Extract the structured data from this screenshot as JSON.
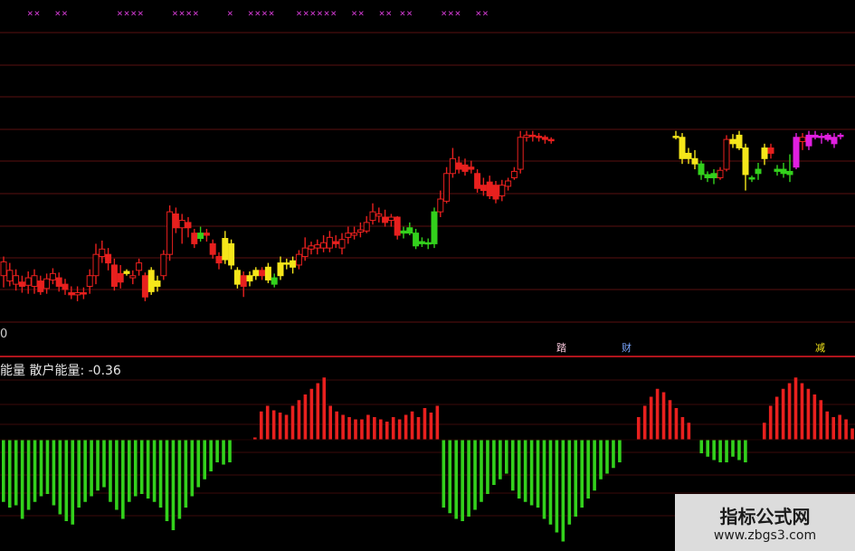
{
  "top_marks": "××  ××       ××××    ××××    ×  ××××   ××××××  ××  ×× ××    ×××  ××",
  "zero_label": "0",
  "indicator_label": "能量  散户能量: -0.36",
  "markers": [
    "踏",
    "财",
    "减"
  ],
  "watermark": {
    "title": "指标公式网",
    "url": "www.zbgs3.com"
  },
  "colors": {
    "up": "#e8201e",
    "down": "#e8201e",
    "yellow": "#f5e61a",
    "green": "#33d11c",
    "magenta": "#e01fe0",
    "grid": "#5a0f0f",
    "divider": "#b0141c"
  },
  "chart_data": [
    {
      "type": "candlestick",
      "note": "price candles, colored by signal",
      "candles": [
        {
          "o": 300,
          "c": 313,
          "h": 318,
          "l": 289,
          "col": "red"
        },
        {
          "o": 295,
          "c": 305,
          "h": 312,
          "l": 290,
          "col": "red"
        },
        {
          "o": 292,
          "c": 300,
          "h": 306,
          "l": 286,
          "col": "red"
        },
        {
          "o": 294,
          "c": 290,
          "h": 300,
          "l": 284,
          "col": "red"
        },
        {
          "o": 291,
          "c": 298,
          "h": 304,
          "l": 283,
          "col": "red"
        },
        {
          "o": 290,
          "c": 300,
          "h": 306,
          "l": 283,
          "col": "red"
        },
        {
          "o": 295,
          "c": 285,
          "h": 300,
          "l": 282,
          "col": "red"
        },
        {
          "o": 288,
          "c": 297,
          "h": 302,
          "l": 283,
          "col": "red"
        },
        {
          "o": 296,
          "c": 302,
          "h": 307,
          "l": 292,
          "col": "red"
        },
        {
          "o": 298,
          "c": 290,
          "h": 303,
          "l": 285,
          "col": "red"
        },
        {
          "o": 292,
          "c": 287,
          "h": 297,
          "l": 282,
          "col": "red"
        },
        {
          "o": 284,
          "c": 282,
          "h": 290,
          "l": 278,
          "col": "red"
        },
        {
          "o": 282,
          "c": 284,
          "h": 290,
          "l": 276,
          "col": "red"
        },
        {
          "o": 284,
          "c": 283,
          "h": 289,
          "l": 278,
          "col": "red"
        },
        {
          "o": 290,
          "c": 300,
          "h": 306,
          "l": 283,
          "col": "red"
        },
        {
          "o": 300,
          "c": 320,
          "h": 330,
          "l": 292,
          "col": "red"
        },
        {
          "o": 318,
          "c": 325,
          "h": 333,
          "l": 312,
          "col": "red"
        },
        {
          "o": 320,
          "c": 312,
          "h": 326,
          "l": 305,
          "col": "red"
        },
        {
          "o": 310,
          "c": 290,
          "h": 316,
          "l": 286,
          "col": "red"
        },
        {
          "o": 302,
          "c": 294,
          "h": 310,
          "l": 288,
          "col": "red"
        },
        {
          "o": 302,
          "c": 304,
          "h": 306,
          "l": 300,
          "col": "yellow"
        },
        {
          "o": 298,
          "c": 300,
          "h": 305,
          "l": 292,
          "col": "red"
        },
        {
          "o": 305,
          "c": 312,
          "h": 316,
          "l": 300,
          "col": "red"
        },
        {
          "o": 300,
          "c": 280,
          "h": 303,
          "l": 276,
          "col": "red"
        },
        {
          "o": 285,
          "c": 305,
          "h": 308,
          "l": 282,
          "col": "yellow"
        },
        {
          "o": 295,
          "c": 290,
          "h": 300,
          "l": 285,
          "col": "yellow"
        },
        {
          "o": 300,
          "c": 320,
          "h": 324,
          "l": 296,
          "col": "red"
        },
        {
          "o": 320,
          "c": 360,
          "h": 366,
          "l": 314,
          "col": "red"
        },
        {
          "o": 358,
          "c": 345,
          "h": 364,
          "l": 340,
          "col": "red"
        },
        {
          "o": 345,
          "c": 352,
          "h": 358,
          "l": 330,
          "col": "red"
        },
        {
          "o": 350,
          "c": 345,
          "h": 355,
          "l": 336,
          "col": "red"
        },
        {
          "o": 340,
          "c": 330,
          "h": 344,
          "l": 326,
          "col": "red"
        },
        {
          "o": 335,
          "c": 340,
          "h": 346,
          "l": 332,
          "col": "green"
        },
        {
          "o": 340,
          "c": 338,
          "h": 344,
          "l": 332,
          "col": "red"
        },
        {
          "o": 330,
          "c": 320,
          "h": 334,
          "l": 316,
          "col": "red"
        },
        {
          "o": 318,
          "c": 312,
          "h": 322,
          "l": 306,
          "col": "red"
        },
        {
          "o": 315,
          "c": 335,
          "h": 342,
          "l": 311,
          "col": "yellow"
        },
        {
          "o": 330,
          "c": 310,
          "h": 334,
          "l": 306,
          "col": "yellow"
        },
        {
          "o": 305,
          "c": 292,
          "h": 308,
          "l": 288,
          "col": "yellow"
        },
        {
          "o": 300,
          "c": 290,
          "h": 304,
          "l": 280,
          "col": "red"
        },
        {
          "o": 295,
          "c": 300,
          "h": 304,
          "l": 290,
          "col": "yellow"
        },
        {
          "o": 300,
          "c": 305,
          "h": 308,
          "l": 296,
          "col": "yellow"
        },
        {
          "o": 305,
          "c": 300,
          "h": 308,
          "l": 296,
          "col": "red"
        },
        {
          "o": 296,
          "c": 308,
          "h": 312,
          "l": 293,
          "col": "yellow"
        },
        {
          "o": 298,
          "c": 292,
          "h": 302,
          "l": 289,
          "col": "green"
        },
        {
          "o": 300,
          "c": 312,
          "h": 318,
          "l": 296,
          "col": "yellow"
        },
        {
          "o": 312,
          "c": 312,
          "h": 316,
          "l": 306,
          "col": "yellow"
        },
        {
          "o": 314,
          "c": 308,
          "h": 318,
          "l": 302,
          "col": "yellow"
        },
        {
          "o": 310,
          "c": 320,
          "h": 324,
          "l": 306,
          "col": "red"
        },
        {
          "o": 318,
          "c": 326,
          "h": 336,
          "l": 314,
          "col": "red"
        },
        {
          "o": 325,
          "c": 328,
          "h": 332,
          "l": 320,
          "col": "red"
        },
        {
          "o": 326,
          "c": 329,
          "h": 334,
          "l": 320,
          "col": "red"
        },
        {
          "o": 326,
          "c": 331,
          "h": 338,
          "l": 322,
          "col": "red"
        },
        {
          "o": 326,
          "c": 336,
          "h": 342,
          "l": 322,
          "col": "red"
        },
        {
          "o": 332,
          "c": 330,
          "h": 338,
          "l": 326,
          "col": "red"
        },
        {
          "o": 326,
          "c": 334,
          "h": 340,
          "l": 320,
          "col": "red"
        },
        {
          "o": 336,
          "c": 340,
          "h": 346,
          "l": 330,
          "col": "red"
        },
        {
          "o": 338,
          "c": 340,
          "h": 346,
          "l": 334,
          "col": "red"
        },
        {
          "o": 341,
          "c": 343,
          "h": 350,
          "l": 336,
          "col": "red"
        },
        {
          "o": 342,
          "c": 350,
          "h": 356,
          "l": 340,
          "col": "red"
        },
        {
          "o": 352,
          "c": 360,
          "h": 368,
          "l": 348,
          "col": "red"
        },
        {
          "o": 356,
          "c": 358,
          "h": 364,
          "l": 350,
          "col": "red"
        },
        {
          "o": 355,
          "c": 350,
          "h": 362,
          "l": 346,
          "col": "red"
        },
        {
          "o": 352,
          "c": 355,
          "h": 358,
          "l": 346,
          "col": "red"
        },
        {
          "o": 355,
          "c": 338,
          "h": 356,
          "l": 334,
          "col": "red"
        },
        {
          "o": 340,
          "c": 342,
          "h": 346,
          "l": 335,
          "col": "green"
        },
        {
          "o": 345,
          "c": 340,
          "h": 350,
          "l": 338,
          "col": "green"
        },
        {
          "o": 340,
          "c": 328,
          "h": 344,
          "l": 325,
          "col": "green"
        },
        {
          "o": 332,
          "c": 330,
          "h": 336,
          "l": 327,
          "col": "green"
        },
        {
          "o": 330,
          "c": 331,
          "h": 335,
          "l": 325,
          "col": "green"
        },
        {
          "o": 330,
          "c": 360,
          "h": 364,
          "l": 326,
          "col": "green"
        },
        {
          "o": 360,
          "c": 372,
          "h": 380,
          "l": 355,
          "col": "red"
        },
        {
          "o": 370,
          "c": 396,
          "h": 402,
          "l": 368,
          "col": "red"
        },
        {
          "o": 396,
          "c": 410,
          "h": 420,
          "l": 392,
          "col": "red"
        },
        {
          "o": 406,
          "c": 400,
          "h": 412,
          "l": 396,
          "col": "red"
        },
        {
          "o": 404,
          "c": 398,
          "h": 410,
          "l": 394,
          "col": "red"
        },
        {
          "o": 402,
          "c": 400,
          "h": 408,
          "l": 396,
          "col": "red"
        },
        {
          "o": 396,
          "c": 382,
          "h": 400,
          "l": 378,
          "col": "red"
        },
        {
          "o": 385,
          "c": 380,
          "h": 392,
          "l": 375,
          "col": "red"
        },
        {
          "o": 388,
          "c": 375,
          "h": 394,
          "l": 372,
          "col": "red"
        },
        {
          "o": 385,
          "c": 372,
          "h": 389,
          "l": 368,
          "col": "red"
        },
        {
          "o": 375,
          "c": 385,
          "h": 390,
          "l": 370,
          "col": "red"
        },
        {
          "o": 384,
          "c": 389,
          "h": 392,
          "l": 380,
          "col": "red"
        },
        {
          "o": 392,
          "c": 398,
          "h": 402,
          "l": 390,
          "col": "red"
        },
        {
          "o": 400,
          "c": 430,
          "h": 436,
          "l": 396,
          "col": "red"
        },
        {
          "o": 430,
          "c": 432,
          "h": 436,
          "l": 426,
          "col": "red"
        },
        {
          "o": 432,
          "c": 431,
          "h": 436,
          "l": 426,
          "col": "red"
        },
        {
          "o": 431,
          "c": 430,
          "h": 434,
          "l": 426,
          "col": "red"
        },
        {
          "o": 430,
          "c": 428,
          "h": 432,
          "l": 424,
          "col": "red"
        },
        {
          "o": 428,
          "c": 427,
          "h": 430,
          "l": 424,
          "col": "red"
        }
      ],
      "candles_right": [
        {
          "o": 430,
          "c": 431,
          "h": 436,
          "l": 428,
          "col": "yellow"
        },
        {
          "o": 430,
          "c": 410,
          "h": 434,
          "l": 405,
          "col": "yellow"
        },
        {
          "o": 410,
          "c": 415,
          "h": 420,
          "l": 405,
          "col": "yellow"
        },
        {
          "o": 410,
          "c": 405,
          "h": 418,
          "l": 400,
          "col": "yellow"
        },
        {
          "o": 405,
          "c": 395,
          "h": 408,
          "l": 390,
          "col": "green"
        },
        {
          "o": 392,
          "c": 395,
          "h": 398,
          "l": 388,
          "col": "green"
        },
        {
          "o": 396,
          "c": 392,
          "h": 400,
          "l": 386,
          "col": "green"
        },
        {
          "o": 392,
          "c": 399,
          "h": 402,
          "l": 390,
          "col": "red"
        },
        {
          "o": 400,
          "c": 428,
          "h": 432,
          "l": 398,
          "col": "red"
        },
        {
          "o": 428,
          "c": 424,
          "h": 433,
          "l": 420,
          "col": "yellow"
        },
        {
          "o": 420,
          "c": 432,
          "h": 436,
          "l": 418,
          "col": "yellow"
        },
        {
          "o": 420,
          "c": 395,
          "h": 424,
          "l": 380,
          "col": "yellow"
        },
        {
          "o": 392,
          "c": 392,
          "h": 394,
          "l": 388,
          "col": "green"
        },
        {
          "o": 396,
          "c": 400,
          "h": 406,
          "l": 390,
          "col": "green"
        },
        {
          "o": 410,
          "c": 420,
          "h": 424,
          "l": 404,
          "col": "yellow"
        },
        {
          "o": 420,
          "c": 415,
          "h": 424,
          "l": 410,
          "col": "red"
        },
        {
          "o": 400,
          "c": 398,
          "h": 404,
          "l": 394,
          "col": "green"
        },
        {
          "o": 396,
          "c": 400,
          "h": 406,
          "l": 392,
          "col": "green"
        },
        {
          "o": 395,
          "c": 398,
          "h": 414,
          "l": 388,
          "col": "green"
        },
        {
          "o": 402,
          "c": 430,
          "h": 434,
          "l": 400,
          "col": "magenta"
        },
        {
          "o": 426,
          "c": 430,
          "h": 434,
          "l": 418,
          "col": "red"
        },
        {
          "o": 422,
          "c": 432,
          "h": 436,
          "l": 418,
          "col": "magenta"
        },
        {
          "o": 432,
          "c": 430,
          "h": 436,
          "l": 428,
          "col": "magenta"
        },
        {
          "o": 431,
          "c": 430,
          "h": 434,
          "l": 424,
          "col": "magenta"
        },
        {
          "o": 428,
          "c": 432,
          "h": 434,
          "l": 426,
          "col": "magenta"
        },
        {
          "o": 430,
          "c": 424,
          "h": 434,
          "l": 420,
          "col": "magenta"
        },
        {
          "o": 432,
          "c": 431,
          "h": 434,
          "l": 428,
          "col": "magenta"
        }
      ]
    },
    {
      "type": "bar",
      "series_label": "散户能量",
      "last_value": -0.36,
      "values": [
        -0.55,
        -0.6,
        -0.58,
        -0.7,
        -0.62,
        -0.55,
        -0.5,
        -0.48,
        -0.58,
        -0.66,
        -0.72,
        -0.75,
        -0.6,
        -0.55,
        -0.5,
        -0.45,
        -0.42,
        -0.55,
        -0.62,
        -0.7,
        -0.55,
        -0.5,
        -0.48,
        -0.52,
        -0.55,
        -0.6,
        -0.72,
        -0.8,
        -0.7,
        -0.6,
        -0.5,
        -0.42,
        -0.35,
        -0.28,
        -0.2,
        -0.22,
        -0.2,
        0.0,
        0.0,
        0.0,
        0.02,
        0.25,
        0.3,
        0.26,
        0.24,
        0.22,
        0.3,
        0.35,
        0.4,
        0.45,
        0.5,
        0.55,
        0.3,
        0.25,
        0.22,
        0.2,
        0.18,
        0.18,
        0.22,
        0.2,
        0.18,
        0.16,
        0.2,
        0.18,
        0.22,
        0.25,
        0.2,
        0.28,
        0.24,
        0.3,
        -0.6,
        -0.65,
        -0.7,
        -0.72,
        -0.68,
        -0.62,
        -0.55,
        -0.48,
        -0.4,
        -0.35,
        -0.3,
        -0.45,
        -0.52,
        -0.55,
        -0.58,
        -0.6,
        -0.7,
        -0.75,
        -0.82,
        -0.9,
        -0.75,
        -0.68,
        -0.6,
        -0.52,
        -0.45,
        -0.35,
        -0.3,
        -0.25,
        -0.2,
        0.0,
        0.0,
        0.2,
        0.3,
        0.38,
        0.45,
        0.42,
        0.35,
        0.28,
        0.2,
        0.15,
        0.0,
        -0.12,
        -0.15,
        -0.18,
        -0.2,
        -0.2,
        -0.15,
        -0.18,
        -0.2,
        0.0,
        0.0,
        0.15,
        0.3,
        0.38,
        0.45,
        0.5,
        0.55,
        0.5,
        0.45,
        0.4,
        0.35,
        0.25,
        0.2,
        0.22,
        0.18,
        0.1,
        0.05
      ]
    }
  ]
}
